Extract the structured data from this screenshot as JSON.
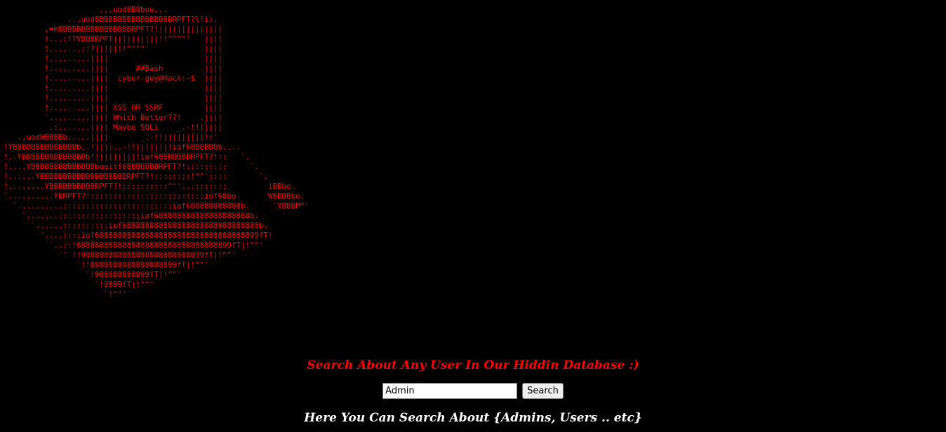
{
  "colors": {
    "background": "#000000",
    "ascii_art": "#ff0000",
    "headline": "#ff0000",
    "subline": "#ffffff"
  },
  "ascii_art": "                     .,,uod8B8bou,,.\n              ..,uod8BBBBBBBBBBBBBBBBRPFT?l!i:.\n         ,=m8BBBBBBBBBBBBBBBRPFT?!||||||||||||||\n         !...:!TVBBBRPFT||||||||||!!^^\"\"'   ||||\n         !.......:!?|||||!!^^\"\"'            ||||\n         !.........||||                     ||||\n         !.........||||      ##Bash         ||||\n         !.........||||  cyber-guy@Hack:~$  ||||\n         !.........||||                     ||||\n         !.........||||                     ||||\n         !.........|||| XSS OR SSRF         ||||\n         `.........|||| Which Better??!    .||||\n          .:.......|||| Maybe SQLi    _.-!!|||||\n   .,uodWBBBBb.....||||       _.-!!|||||||||!:'\n!YBBBBBBBBBBBBBBb..!|||:..-!!|||||||!iof68BBBBBb....\n!..YBBBBBBBBBBBBBBb!!||||||||!iof68BBBBBBRPFT?!::   `.\n!....YBBBBBBBBBBBBBBbaaitf68BBBBBBRPFT?!:::::::::     `.\n!......YBBBBBBBBBBBBBBBBBBBRPFT?!::::::;:!^\"`;:::       `.\n!........YBBBBBBBBBBRPFT?!::::::::::^''...::::::;         iBBbo.\n`..........YBRPFT?!::::::::::::::::::::::::;iof68bo.      WBBBBbo.\n  `..........:::::::::::::::::::::::;iof688888888888b.     `YBBBP^'\n    `........::::::::::::::::;iof688888888888888888888b.     `\n      `......:::::::::;iof688888888888888888888888888888b.\n        `....:::;iof688888888888888888888888888888888899fT!\n          `..::!8888888888888888888888888888888899fT|!^\"'\n            `' !!988888888888888888888888899fT|!^\"'\n                `!!8888888888888888899fT|!^\"'\n                  `!988888888899fT|!^\"'\n                    `!9899fT|!^\"'\n                      `!^\"'",
  "headline": "Search About Any User In Our Hiddin Database :)",
  "search": {
    "value": "Admin",
    "button_label": "Search"
  },
  "subline": "Here You Can Search About {Admins, Users .. etc}"
}
